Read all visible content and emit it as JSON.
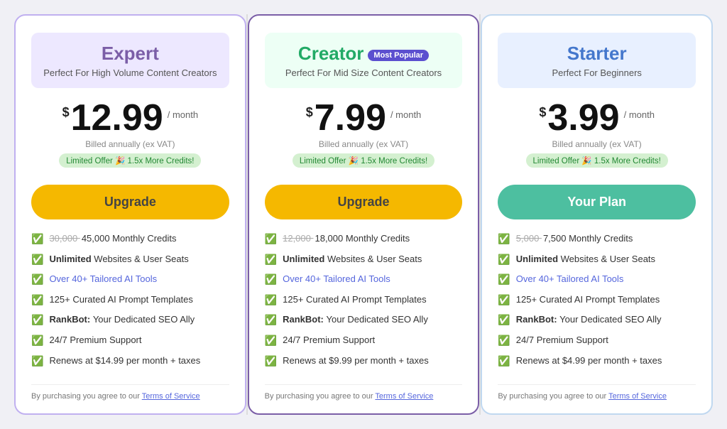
{
  "plans": [
    {
      "id": "expert",
      "title": "Expert",
      "subtitle": "Perfect For High Volume Content Creators",
      "most_popular": false,
      "price_dollar": "$",
      "price_amount": "12.99",
      "price_period": "/ month",
      "billing_note": "Billed annually (ex VAT)",
      "limited_offer": "Limited Offer 🎉 1.5x More Credits!",
      "button_label": "Upgrade",
      "button_type": "yellow",
      "header_class": "expert-header",
      "title_class": "expert",
      "features": [
        {
          "strikethrough": "30,000",
          "main": "45,000 Monthly Credits",
          "link": false
        },
        {
          "strikethrough": "",
          "main": "Unlimited Websites & User Seats",
          "bold_part": "Unlimited",
          "link": false
        },
        {
          "strikethrough": "",
          "main": "Over 40+ Tailored AI Tools",
          "link": true,
          "link_text": "Over 40+ Tailored AI Tools"
        },
        {
          "strikethrough": "",
          "main": "125+ Curated AI Prompt Templates",
          "bold_part": "Curated",
          "link": false
        },
        {
          "strikethrough": "",
          "main": "RankBot: Your Dedicated SEO Ally",
          "bold_part": "RankBot:",
          "link": false
        },
        {
          "strikethrough": "",
          "main": "24/7 Premium Support",
          "bold_part": "Premium",
          "link": false
        },
        {
          "strikethrough": "",
          "main": "Renews at $14.99 per month + taxes",
          "link": false
        }
      ],
      "terms": "By purchasing you agree to our Terms of Service",
      "terms_link": "Terms of Service"
    },
    {
      "id": "creator",
      "title": "Creator",
      "subtitle": "Perfect For Mid Size Content Creators",
      "most_popular": true,
      "most_popular_label": "Most Popular",
      "price_dollar": "$",
      "price_amount": "7.99",
      "price_period": "/ month",
      "billing_note": "Billed annually (ex VAT)",
      "limited_offer": "Limited Offer 🎉 1.5x More Credits!",
      "button_label": "Upgrade",
      "button_type": "yellow",
      "header_class": "creator-header",
      "title_class": "creator",
      "features": [
        {
          "strikethrough": "12,000",
          "main": "18,000 Monthly Credits",
          "link": false
        },
        {
          "strikethrough": "",
          "main": "Unlimited Websites & User Seats",
          "bold_part": "Unlimited",
          "link": false
        },
        {
          "strikethrough": "",
          "main": "Over 40+ Tailored AI Tools",
          "link": true,
          "link_text": "Over 40+ Tailored AI Tools"
        },
        {
          "strikethrough": "",
          "main": "125+ Curated AI Prompt Templates",
          "bold_part": "Curated",
          "link": false
        },
        {
          "strikethrough": "",
          "main": "RankBot: Your Dedicated SEO Ally",
          "bold_part": "RankBot:",
          "link": false
        },
        {
          "strikethrough": "",
          "main": "24/7 Premium Support",
          "bold_part": "Premium",
          "link": false
        },
        {
          "strikethrough": "",
          "main": "Renews at $9.99 per month + taxes",
          "link": false
        }
      ],
      "terms": "By purchasing you agree to our Terms of Service",
      "terms_link": "Terms of Service"
    },
    {
      "id": "starter",
      "title": "Starter",
      "subtitle": "Perfect For Beginners",
      "most_popular": false,
      "price_dollar": "$",
      "price_amount": "3.99",
      "price_period": "/ month",
      "billing_note": "Billed annually (ex VAT)",
      "limited_offer": "Limited Offer 🎉 1.5x More Credits!",
      "button_label": "Your Plan",
      "button_type": "teal",
      "header_class": "starter-header",
      "title_class": "starter",
      "features": [
        {
          "strikethrough": "5,000",
          "main": "7,500 Monthly Credits",
          "link": false
        },
        {
          "strikethrough": "",
          "main": "Unlimited Websites & User Seats",
          "bold_part": "Unlimited",
          "link": false
        },
        {
          "strikethrough": "",
          "main": "Over 40+ Tailored AI Tools",
          "link": true,
          "link_text": "Over 40+ Tailored AI Tools"
        },
        {
          "strikethrough": "",
          "main": "125+ Curated AI Prompt Templates",
          "bold_part": "Curated",
          "link": false
        },
        {
          "strikethrough": "",
          "main": "RankBot: Your Dedicated SEO Ally",
          "bold_part": "RankBot:",
          "link": false
        },
        {
          "strikethrough": "",
          "main": "24/7 Premium Support",
          "bold_part": "Premium",
          "link": false
        },
        {
          "strikethrough": "",
          "main": "Renews at $4.99 per month + taxes",
          "link": false
        }
      ],
      "terms": "By purchasing you agree to our Terms of Service",
      "terms_link": "Terms of Service"
    }
  ]
}
